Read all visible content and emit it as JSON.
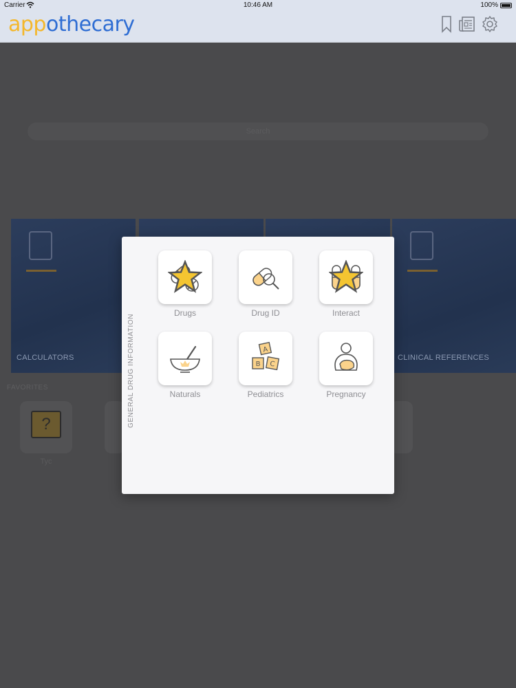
{
  "status_bar": {
    "carrier": "Carrier",
    "time": "10:46 AM",
    "battery": "100%"
  },
  "app": {
    "logo_part1": "app",
    "logo_part2": "othecary"
  },
  "header_icons": [
    "bookmark-icon",
    "news-icon",
    "gear-icon"
  ],
  "background": {
    "search_placeholder": "Search",
    "tiles": [
      {
        "label": "CALCULATORS"
      },
      {
        "label": ""
      },
      {
        "label": ""
      },
      {
        "label": "CLINICAL REFERENCES"
      }
    ],
    "favorites_label": "FAVORITES",
    "favorite_caption": "Tyc"
  },
  "popup": {
    "section_label": "GENERAL DRUG INFORMATION",
    "items": [
      {
        "label": "Drugs",
        "icon": "pills-icon",
        "favorite": true
      },
      {
        "label": "Drug ID",
        "icon": "pill-magnifier-icon",
        "favorite": false
      },
      {
        "label": "Interact",
        "icon": "interaction-icon",
        "favorite": true
      },
      {
        "label": "Naturals",
        "icon": "mortar-pestle-icon",
        "favorite": false
      },
      {
        "label": "Pediatrics",
        "icon": "abc-blocks-icon",
        "favorite": false
      },
      {
        "label": "Pregnancy",
        "icon": "pregnancy-icon",
        "favorite": false
      }
    ]
  },
  "colors": {
    "accent_yellow": "#f4b72b",
    "brand_blue": "#2e6dd3",
    "icon_fill": "#fbd38b"
  }
}
